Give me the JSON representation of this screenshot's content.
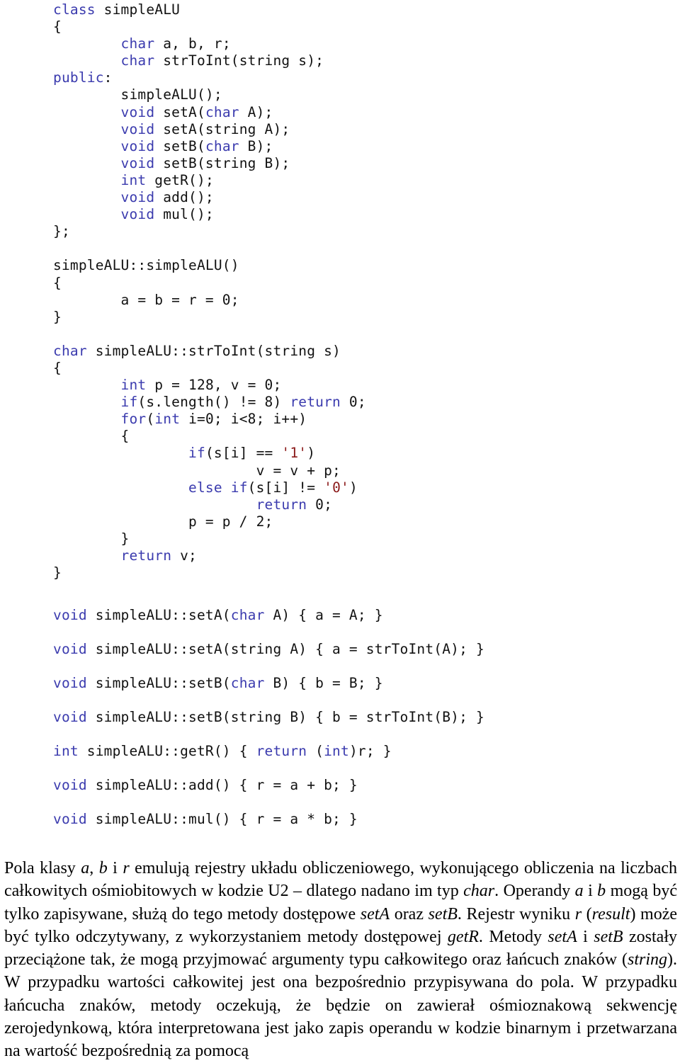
{
  "document": {
    "language": "pl",
    "kind": "textbook-page",
    "colors": {
      "keyword": "#3b3bae",
      "literal": "#8b1a1a",
      "text": "#111111",
      "background": "#ffffff"
    }
  },
  "code": {
    "language": "C++",
    "class_name": "simpleALU",
    "lines": [
      {
        "indent": 0,
        "tokens": [
          {
            "t": "class",
            "c": "kw"
          },
          {
            "t": " simpleALU",
            "c": "pl"
          }
        ]
      },
      {
        "indent": 0,
        "tokens": [
          {
            "t": "{",
            "c": "pl"
          }
        ]
      },
      {
        "indent": 1,
        "tokens": [
          {
            "t": "char",
            "c": "kw"
          },
          {
            "t": " a, b, r;",
            "c": "pl"
          }
        ]
      },
      {
        "indent": 1,
        "tokens": [
          {
            "t": "char",
            "c": "kw"
          },
          {
            "t": " strToInt(string s);",
            "c": "pl"
          }
        ]
      },
      {
        "indent": 0,
        "tokens": [
          {
            "t": "public",
            "c": "kw"
          },
          {
            "t": ":",
            "c": "pl"
          }
        ]
      },
      {
        "indent": 1,
        "tokens": [
          {
            "t": "simpleALU();",
            "c": "pl"
          }
        ]
      },
      {
        "indent": 1,
        "tokens": [
          {
            "t": "void",
            "c": "kw"
          },
          {
            "t": " setA(",
            "c": "pl"
          },
          {
            "t": "char",
            "c": "kw"
          },
          {
            "t": " A);",
            "c": "pl"
          }
        ]
      },
      {
        "indent": 1,
        "tokens": [
          {
            "t": "void",
            "c": "kw"
          },
          {
            "t": " setA(string A);",
            "c": "pl"
          }
        ]
      },
      {
        "indent": 1,
        "tokens": [
          {
            "t": "void",
            "c": "kw"
          },
          {
            "t": " setB(",
            "c": "pl"
          },
          {
            "t": "char",
            "c": "kw"
          },
          {
            "t": " B);",
            "c": "pl"
          }
        ]
      },
      {
        "indent": 1,
        "tokens": [
          {
            "t": "void",
            "c": "kw"
          },
          {
            "t": " setB(string B);",
            "c": "pl"
          }
        ]
      },
      {
        "indent": 1,
        "tokens": [
          {
            "t": "int",
            "c": "kw"
          },
          {
            "t": " getR();",
            "c": "pl"
          }
        ]
      },
      {
        "indent": 1,
        "tokens": [
          {
            "t": "void",
            "c": "kw"
          },
          {
            "t": " add();",
            "c": "pl"
          }
        ]
      },
      {
        "indent": 1,
        "tokens": [
          {
            "t": "void",
            "c": "kw"
          },
          {
            "t": " mul();",
            "c": "pl"
          }
        ]
      },
      {
        "indent": 0,
        "tokens": [
          {
            "t": "};",
            "c": "pl"
          }
        ]
      },
      {
        "indent": 0,
        "tokens": []
      },
      {
        "indent": 0,
        "tokens": [
          {
            "t": "simpleALU::simpleALU()",
            "c": "pl"
          }
        ]
      },
      {
        "indent": 0,
        "tokens": [
          {
            "t": "{",
            "c": "pl"
          }
        ]
      },
      {
        "indent": 1,
        "tokens": [
          {
            "t": "a = b = r = 0;",
            "c": "pl"
          }
        ]
      },
      {
        "indent": 0,
        "tokens": [
          {
            "t": "}",
            "c": "pl"
          }
        ]
      },
      {
        "indent": 0,
        "tokens": []
      },
      {
        "indent": 0,
        "tokens": [
          {
            "t": "char",
            "c": "kw"
          },
          {
            "t": " simpleALU::strToInt(string s)",
            "c": "pl"
          }
        ]
      },
      {
        "indent": 0,
        "tokens": [
          {
            "t": "{",
            "c": "pl"
          }
        ]
      },
      {
        "indent": 1,
        "tokens": [
          {
            "t": "int",
            "c": "kw"
          },
          {
            "t": " p = 128, v = 0;",
            "c": "pl"
          }
        ]
      },
      {
        "indent": 1,
        "tokens": [
          {
            "t": "if",
            "c": "kw"
          },
          {
            "t": "(s.length() != 8) ",
            "c": "pl"
          },
          {
            "t": "return",
            "c": "kw"
          },
          {
            "t": " 0;",
            "c": "pl"
          }
        ]
      },
      {
        "indent": 1,
        "tokens": [
          {
            "t": "for",
            "c": "kw"
          },
          {
            "t": "(",
            "c": "pl"
          },
          {
            "t": "int",
            "c": "kw"
          },
          {
            "t": " i=0; i<8; i++)",
            "c": "pl"
          }
        ]
      },
      {
        "indent": 1,
        "tokens": [
          {
            "t": "{",
            "c": "pl"
          }
        ]
      },
      {
        "indent": 2,
        "tokens": [
          {
            "t": "if",
            "c": "kw"
          },
          {
            "t": "(s[i] == ",
            "c": "pl"
          },
          {
            "t": "'1'",
            "c": "lit"
          },
          {
            "t": ")",
            "c": "pl"
          }
        ]
      },
      {
        "indent": 3,
        "tokens": [
          {
            "t": "v = v + p;",
            "c": "pl"
          }
        ]
      },
      {
        "indent": 2,
        "tokens": [
          {
            "t": "else",
            "c": "kw"
          },
          {
            "t": " ",
            "c": "pl"
          },
          {
            "t": "if",
            "c": "kw"
          },
          {
            "t": "(s[i] != ",
            "c": "pl"
          },
          {
            "t": "'0'",
            "c": "lit"
          },
          {
            "t": ")",
            "c": "pl"
          }
        ]
      },
      {
        "indent": 3,
        "tokens": [
          {
            "t": "return",
            "c": "kw"
          },
          {
            "t": " 0;",
            "c": "pl"
          }
        ]
      },
      {
        "indent": 2,
        "tokens": [
          {
            "t": "p = p / 2;",
            "c": "pl"
          }
        ]
      },
      {
        "indent": 1,
        "tokens": [
          {
            "t": "}",
            "c": "pl"
          }
        ]
      },
      {
        "indent": 1,
        "tokens": [
          {
            "t": "return",
            "c": "kw"
          },
          {
            "t": " v;",
            "c": "pl"
          }
        ]
      },
      {
        "indent": 0,
        "tokens": [
          {
            "t": "}",
            "c": "pl"
          }
        ]
      },
      {
        "indent": 0,
        "tokens": []
      },
      {
        "indent": 0,
        "spaced": true,
        "tokens": [
          {
            "t": "void",
            "c": "kw"
          },
          {
            "t": " simpleALU::setA(",
            "c": "pl"
          },
          {
            "t": "char",
            "c": "kw"
          },
          {
            "t": " A) { a = A; }",
            "c": "pl"
          }
        ]
      },
      {
        "indent": 0,
        "spaced": true,
        "tokens": [
          {
            "t": "void",
            "c": "kw"
          },
          {
            "t": " simpleALU::setA(string A) { a = strToInt(A); }",
            "c": "pl"
          }
        ]
      },
      {
        "indent": 0,
        "spaced": true,
        "tokens": [
          {
            "t": "void",
            "c": "kw"
          },
          {
            "t": " simpleALU::setB(",
            "c": "pl"
          },
          {
            "t": "char",
            "c": "kw"
          },
          {
            "t": " B) { b = B; }",
            "c": "pl"
          }
        ]
      },
      {
        "indent": 0,
        "spaced": true,
        "tokens": [
          {
            "t": "void",
            "c": "kw"
          },
          {
            "t": " simpleALU::setB(string B) { b = strToInt(B); }",
            "c": "pl"
          }
        ]
      },
      {
        "indent": 0,
        "spaced": true,
        "tokens": [
          {
            "t": "int",
            "c": "kw"
          },
          {
            "t": " simpleALU::getR() { ",
            "c": "pl"
          },
          {
            "t": "return",
            "c": "kw"
          },
          {
            "t": " (",
            "c": "pl"
          },
          {
            "t": "int",
            "c": "kw"
          },
          {
            "t": ")r; }",
            "c": "pl"
          }
        ]
      },
      {
        "indent": 0,
        "spaced": true,
        "tokens": [
          {
            "t": "void",
            "c": "kw"
          },
          {
            "t": " simpleALU::add() { r = a + b; }",
            "c": "pl"
          }
        ]
      },
      {
        "indent": 0,
        "spaced": true,
        "tokens": [
          {
            "t": "void",
            "c": "kw"
          },
          {
            "t": " simpleALU::mul() { r = a * b; }",
            "c": "pl"
          }
        ]
      }
    ]
  },
  "paragraph": {
    "runs": [
      {
        "t": "Pola klasy ",
        "i": false
      },
      {
        "t": "a",
        "i": true
      },
      {
        "t": ", ",
        "i": false
      },
      {
        "t": "b",
        "i": true
      },
      {
        "t": " i ",
        "i": false
      },
      {
        "t": "r",
        "i": true
      },
      {
        "t": " emulują rejestry układu obliczeniowego, wykonującego obliczenia na liczbach całkowitych ośmiobitowych w kodzie U2 – dlatego nadano im typ ",
        "i": false
      },
      {
        "t": "char",
        "i": true
      },
      {
        "t": ". Operandy ",
        "i": false
      },
      {
        "t": "a",
        "i": true
      },
      {
        "t": " i ",
        "i": false
      },
      {
        "t": "b",
        "i": true
      },
      {
        "t": " mogą być tylko zapisywane, służą do tego metody dostępowe ",
        "i": false
      },
      {
        "t": "setA",
        "i": true
      },
      {
        "t": " oraz ",
        "i": false
      },
      {
        "t": "setB",
        "i": true
      },
      {
        "t": ". Rejestr wyniku ",
        "i": false
      },
      {
        "t": "r",
        "i": true
      },
      {
        "t": " (",
        "i": false
      },
      {
        "t": "result",
        "i": true
      },
      {
        "t": ") może być tylko odczytywany, z wykorzystaniem metody dostępowej ",
        "i": false
      },
      {
        "t": "getR",
        "i": true
      },
      {
        "t": ". Metody ",
        "i": false
      },
      {
        "t": "setA",
        "i": true
      },
      {
        "t": " i ",
        "i": false
      },
      {
        "t": "setB",
        "i": true
      },
      {
        "t": " zostały przeciążone tak, że mogą przyjmować argumenty typu całkowitego oraz łańcuch znaków (",
        "i": false
      },
      {
        "t": "string",
        "i": true
      },
      {
        "t": "). W przypadku wartości całkowitej jest ona bezpośrednio przypisywana do pola. W przypadku łańcucha znaków, metody oczekują, że będzie on zawierał ośmioznakową sekwencję zerojedynkową, która interpretowana jest jako zapis operandu w kodzie binarnym i przetwarzana na wartość bezpośrednią za pomocą ",
        "i": false
      }
    ]
  }
}
